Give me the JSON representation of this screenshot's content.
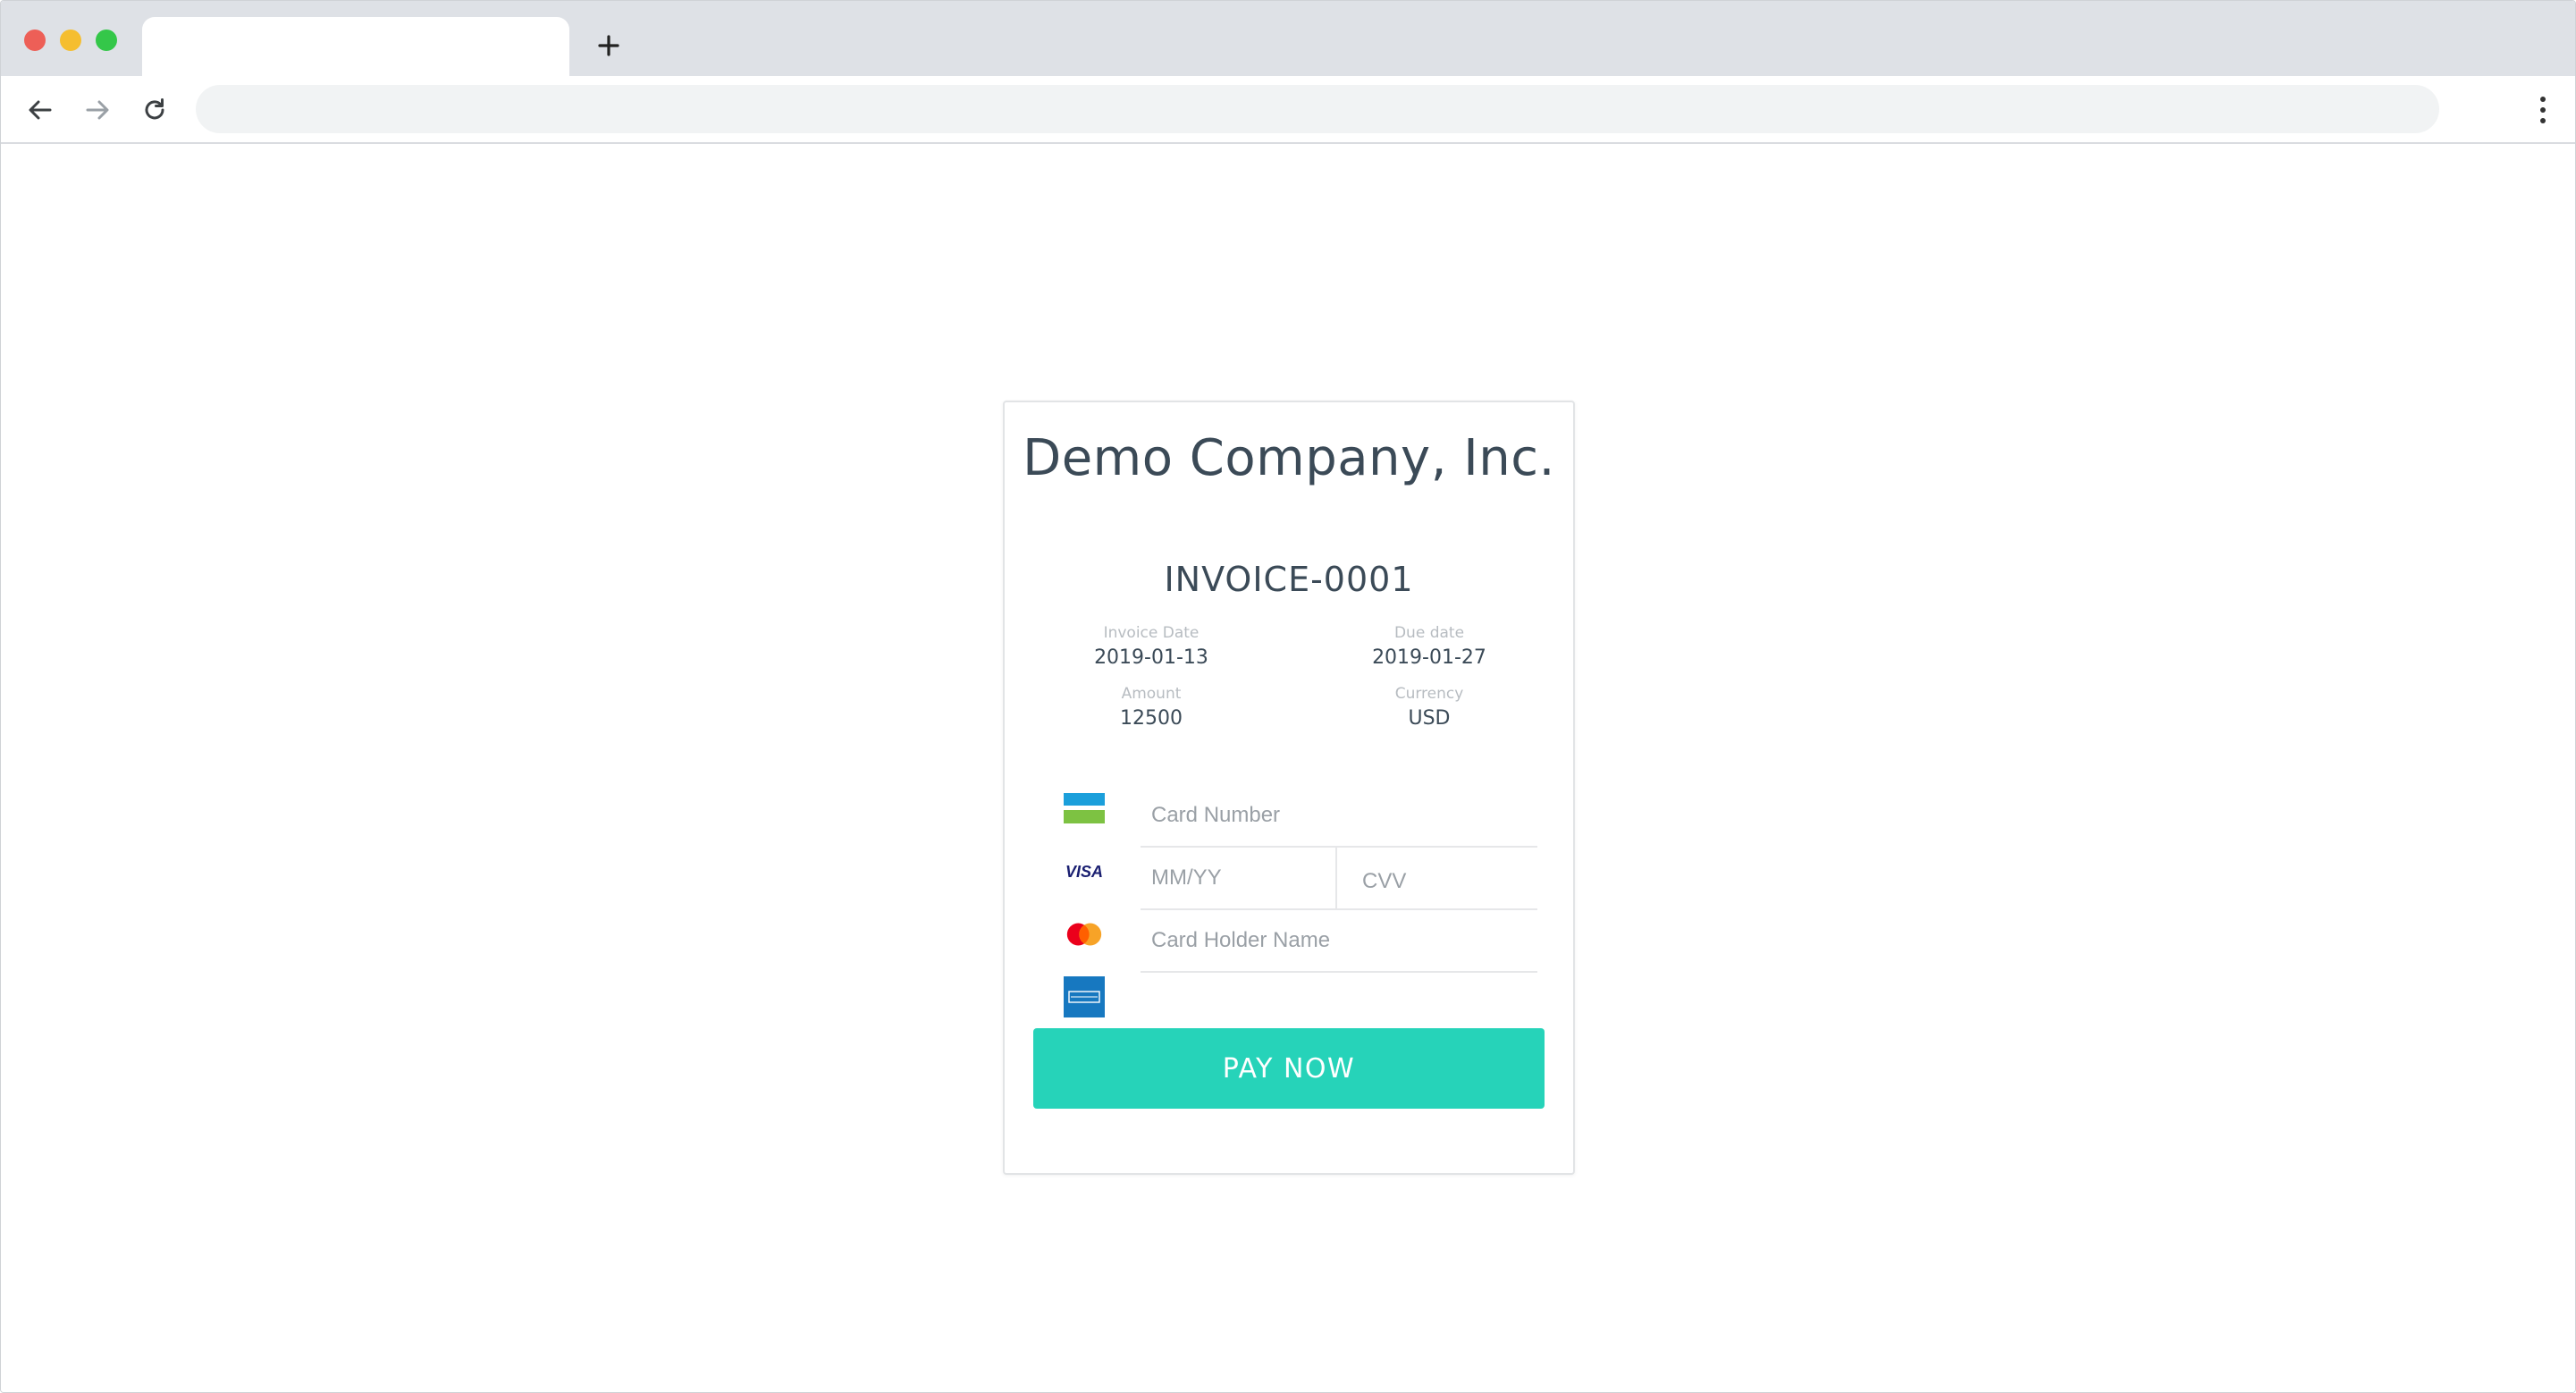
{
  "browser": {
    "tab_title": "",
    "address": ""
  },
  "invoice": {
    "company": "Demo Company, Inc.",
    "number": "INVOICE-0001",
    "invoice_date_label": "Invoice Date",
    "invoice_date": "2019-01-13",
    "due_date_label": "Due date",
    "due_date": "2019-01-27",
    "amount_label": "Amount",
    "amount": "12500",
    "currency_label": "Currency",
    "currency": "USD"
  },
  "payment_form": {
    "card_number_placeholder": "Card Number",
    "expiry_placeholder": "MM/YY",
    "cvv_placeholder": "CVV",
    "holder_placeholder": "Card Holder Name",
    "pay_button_label": "PAY NOW",
    "accepted_brands": [
      "generic-card-icon",
      "visa-icon",
      "mastercard-icon",
      "amex-icon"
    ]
  },
  "colors": {
    "pay_button": "#26d3b9",
    "text_dark": "#3b4a57",
    "label_muted": "#b7bcc1"
  }
}
